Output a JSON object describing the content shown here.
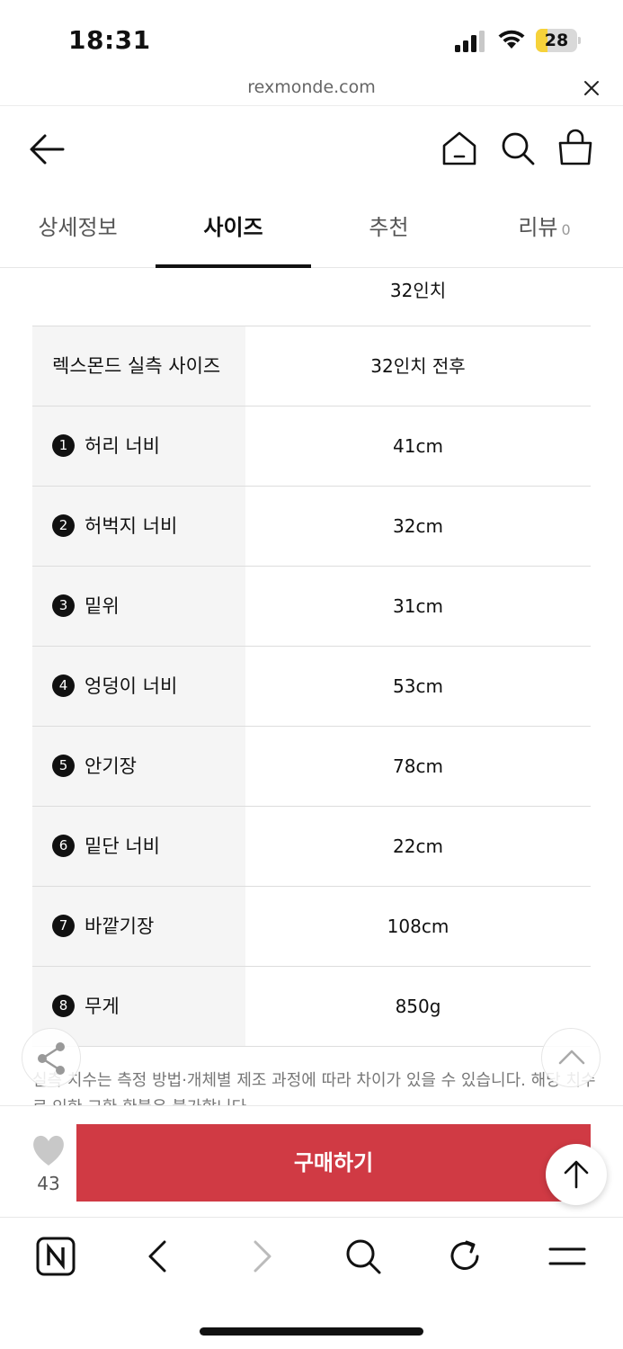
{
  "status_bar": {
    "time": "18:31",
    "battery_level": "28",
    "battery_fraction": 0.28
  },
  "browser": {
    "url": "rexmonde.com"
  },
  "header": {
    "icons": [
      "back-arrow-icon",
      "home-icon",
      "search-icon",
      "shopping-bag-icon"
    ]
  },
  "tabs": [
    {
      "label": "상세정보",
      "active": false
    },
    {
      "label": "사이즈",
      "active": true
    },
    {
      "label": "추천",
      "active": false
    },
    {
      "label": "리뷰",
      "count": "0",
      "active": false
    }
  ],
  "size_info": {
    "previous_value": "32인치",
    "rows": [
      {
        "num": "",
        "label": "렉스몬드 실측 사이즈",
        "value": "32인치 전후"
      },
      {
        "num": "1",
        "label": "허리 너비",
        "value": "41cm"
      },
      {
        "num": "2",
        "label": "허벅지 너비",
        "value": "32cm"
      },
      {
        "num": "3",
        "label": "밑위",
        "value": "31cm"
      },
      {
        "num": "4",
        "label": "엉덩이 너비",
        "value": "53cm"
      },
      {
        "num": "5",
        "label": "안기장",
        "value": "78cm"
      },
      {
        "num": "6",
        "label": "밑단 너비",
        "value": "22cm"
      },
      {
        "num": "7",
        "label": "바깥기장",
        "value": "108cm"
      },
      {
        "num": "8",
        "label": "무게",
        "value": "850g"
      }
    ],
    "notice": "실측 치수는 측정 방법·개체별 제조 과정에 따라 차이가 있을 수 있습니다. 해당 치수로 인한 교환·환불은 불가합니다."
  },
  "purchase": {
    "like_count": "43",
    "buy_label": "구매하기",
    "buy_color": "#d03a44"
  },
  "browser_nav": {
    "icons": [
      "naver-n-icon",
      "nav-back-icon",
      "nav-forward-icon",
      "nav-search-icon",
      "refresh-icon",
      "menu-icon"
    ]
  }
}
